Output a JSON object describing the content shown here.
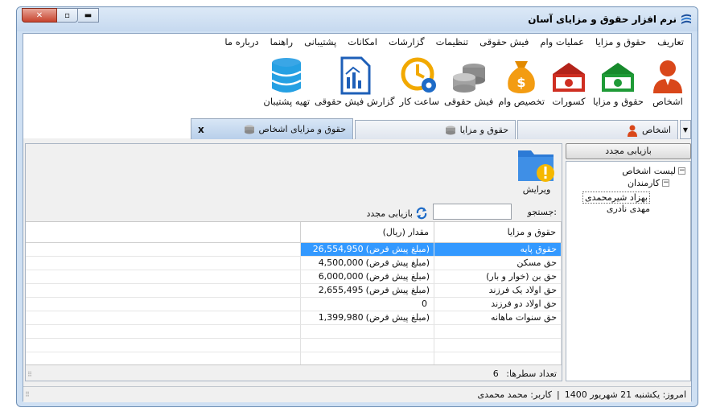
{
  "window": {
    "title": "نرم افزار حقوق و مزایای آسان"
  },
  "menu": [
    "تعاریف",
    "حقوق و مزایا",
    "عملیات وام",
    "فیش حقوقی",
    "تنظیمات",
    "گزارشات",
    "امکانات",
    "پشتیبانی",
    "راهنما",
    "درباره ما"
  ],
  "toolbar": [
    {
      "label": "اشخاص",
      "icon": "person-icon"
    },
    {
      "label": "حقوق و مزایا",
      "icon": "green-money-icon"
    },
    {
      "label": "کسورات",
      "icon": "red-money-icon"
    },
    {
      "label": "تخصیص وام",
      "icon": "money-bag-icon"
    },
    {
      "label": "فیش حقوقی",
      "icon": "coins-icon"
    },
    {
      "label": "ساعت کار",
      "icon": "clock-gear-icon"
    },
    {
      "label": "گزارش فیش حقوقی",
      "icon": "report-icon"
    },
    {
      "label": "تهیه پشتیبان",
      "icon": "database-icon"
    }
  ],
  "tabs": [
    {
      "label": "اشخاص"
    },
    {
      "label": "حقوق و مزایا"
    },
    {
      "label": "حقوق و مزایای اشخاص",
      "close": "x"
    }
  ],
  "sidebar": {
    "refresh_label": "بازیابی مجدد",
    "tree": {
      "root": "لیست اشخاص",
      "group": "کارمندان",
      "people": [
        "بهزاد شیرمحمدی",
        "مهدی نادری"
      ]
    }
  },
  "content": {
    "edit_label": "ویرایش",
    "search_label": "جستجو:",
    "search_value": "",
    "reset_label": "بازیابی مجدد",
    "columns": [
      "حقوق و مزایا",
      "مقدار (ریال)"
    ],
    "rows": [
      {
        "name": "حقوق پایه",
        "amount": "26,554,950",
        "note": "(مبلغ پیش فرض)"
      },
      {
        "name": "حق مسکن",
        "amount": "4,500,000",
        "note": "(مبلغ پیش فرض)"
      },
      {
        "name": "حق بن (خوار و بار)",
        "amount": "6,000,000",
        "note": "(مبلغ پیش فرض)"
      },
      {
        "name": "حق اولاد یک فرزند",
        "amount": "2,655,495",
        "note": "(مبلغ پیش فرض)"
      },
      {
        "name": "حق اولاد دو فرزند",
        "amount": "0",
        "note": ""
      },
      {
        "name": "حق سنوات ماهانه",
        "amount": "1,399,980",
        "note": "(مبلغ پیش فرض)"
      }
    ],
    "row_count_label": "تعداد سطرها:",
    "row_count": "6"
  },
  "status": {
    "date_label": "امروز: یکشنبه 21 شهریور 1400",
    "sep": "|",
    "user_label": "کاربر: محمد محمدی"
  }
}
